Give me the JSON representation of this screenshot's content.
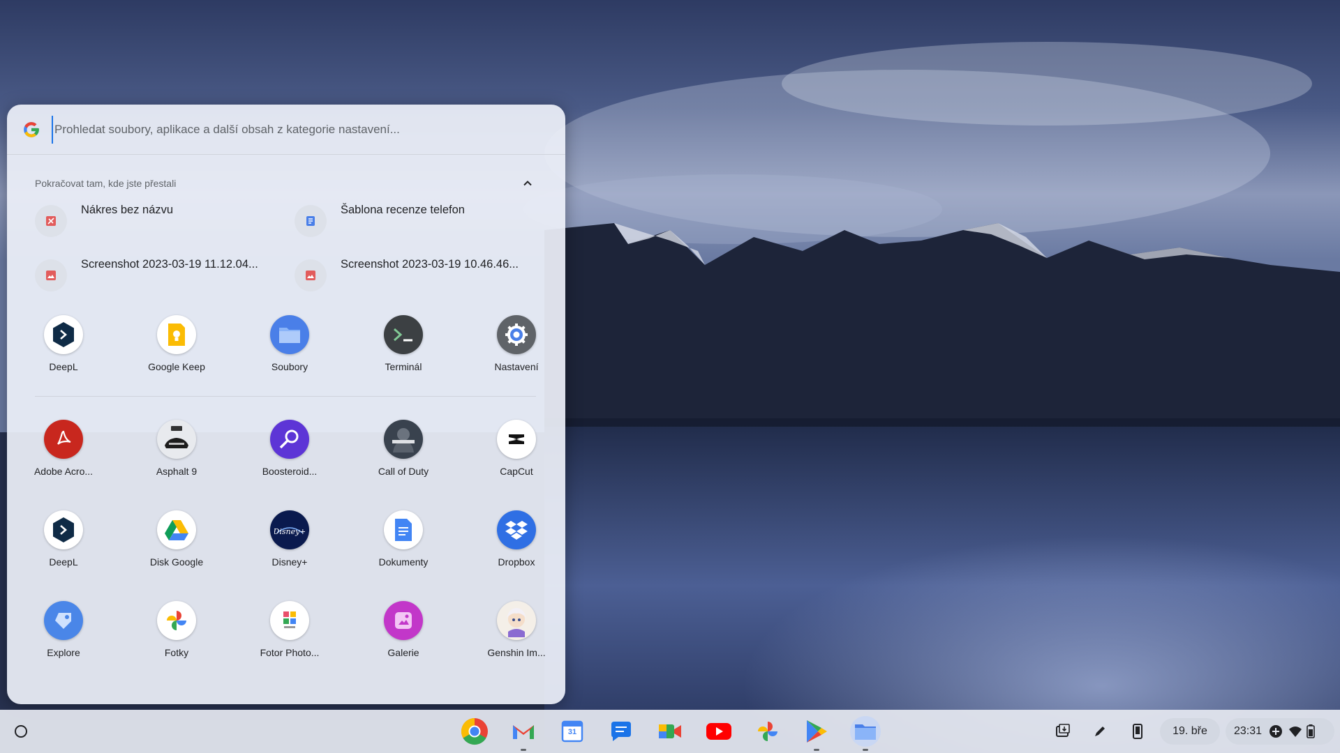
{
  "search": {
    "placeholder": "Prohledat soubory, aplikace a další obsah z kategorie nastavení..."
  },
  "continue": {
    "title": "Pokračovat tam, kde jste přestali",
    "items": [
      {
        "label": "Nákres bez názvu",
        "icon": "drawing-icon"
      },
      {
        "label": "Šablona recenze telefon",
        "icon": "document-icon"
      },
      {
        "label": "Screenshot 2023-03-19 11.12.04...",
        "icon": "image-icon"
      },
      {
        "label": "Screenshot 2023-03-19 10.46.46...",
        "icon": "image-icon"
      }
    ]
  },
  "pinned_apps": [
    {
      "label": "DeepL",
      "icon": "deepl-icon"
    },
    {
      "label": "Google Keep",
      "icon": "keep-icon"
    },
    {
      "label": "Soubory",
      "icon": "files-icon"
    },
    {
      "label": "Terminál",
      "icon": "terminal-icon"
    },
    {
      "label": "Nastavení",
      "icon": "settings-gear-icon"
    }
  ],
  "all_apps": [
    [
      {
        "label": "Adobe Acro...",
        "icon": "acrobat-icon"
      },
      {
        "label": "Asphalt 9",
        "icon": "asphalt-icon"
      },
      {
        "label": "Boosteroid...",
        "icon": "boosteroid-icon"
      },
      {
        "label": "Call of Duty",
        "icon": "callofduty-icon"
      },
      {
        "label": "CapCut",
        "icon": "capcut-icon"
      }
    ],
    [
      {
        "label": "DeepL",
        "icon": "deepl-icon"
      },
      {
        "label": "Disk Google",
        "icon": "drive-icon"
      },
      {
        "label": "Disney+",
        "icon": "disney-icon"
      },
      {
        "label": "Dokumenty",
        "icon": "docs-icon"
      },
      {
        "label": "Dropbox",
        "icon": "dropbox-icon"
      }
    ],
    [
      {
        "label": "Explore",
        "icon": "explore-icon"
      },
      {
        "label": "Fotky",
        "icon": "photos-icon"
      },
      {
        "label": "Fotor Photo...",
        "icon": "fotor-icon"
      },
      {
        "label": "Galerie",
        "icon": "gallery-icon"
      },
      {
        "label": "Genshin Im...",
        "icon": "genshin-icon"
      }
    ]
  ],
  "shelf": {
    "apps": [
      "chrome-icon",
      "gmail-icon",
      "calendar-icon",
      "chat-icon",
      "meet-icon",
      "youtube-icon",
      "photos-icon",
      "play-store-icon",
      "files-icon"
    ],
    "calendar_day": "31",
    "date": "19. bře",
    "time": "23:31"
  },
  "colors": {
    "accent": "#1a73e8",
    "launcher_bg": "#eceff7"
  }
}
